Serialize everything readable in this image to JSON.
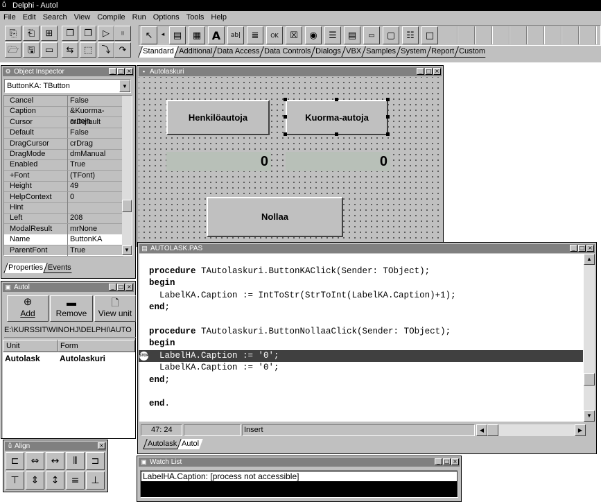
{
  "app": {
    "title": "Delphi - Autol"
  },
  "menu": [
    "File",
    "Edit",
    "Search",
    "View",
    "Compile",
    "Run",
    "Options",
    "Tools",
    "Help"
  ],
  "palette_tabs": [
    "Standard",
    "Additional",
    "Data Access",
    "Data Controls",
    "Dialogs",
    "VBX",
    "Samples",
    "System",
    "Report",
    "Custom"
  ],
  "object_inspector": {
    "title": "Object Inspector",
    "selected": "ButtonKA: TButton",
    "properties": [
      {
        "k": "Cancel",
        "v": "False"
      },
      {
        "k": "Caption",
        "v": "&Kuorma-autoja"
      },
      {
        "k": "Cursor",
        "v": "crDefault"
      },
      {
        "k": "Default",
        "v": "False"
      },
      {
        "k": "DragCursor",
        "v": "crDrag"
      },
      {
        "k": "DragMode",
        "v": "dmManual"
      },
      {
        "k": "Enabled",
        "v": "True"
      },
      {
        "k": "+Font",
        "v": "(TFont)"
      },
      {
        "k": "Height",
        "v": "49"
      },
      {
        "k": "HelpContext",
        "v": "0"
      },
      {
        "k": "Hint",
        "v": ""
      },
      {
        "k": "Left",
        "v": "208"
      },
      {
        "k": "ModalResult",
        "v": "mrNone"
      },
      {
        "k": "Name",
        "v": "ButtonKA"
      },
      {
        "k": "ParentFont",
        "v": "True"
      }
    ],
    "tabs": [
      "Properties",
      "Events"
    ]
  },
  "project": {
    "title": "Autol",
    "buttons": [
      "Add",
      "Remove",
      "View unit"
    ],
    "path": "E:\\KURSSIT\\WINOHJ\\DELPHI\\AUTO",
    "col_unit": "Unit",
    "col_form": "Form",
    "row_unit": "Autolask",
    "row_form": "Autolaskuri"
  },
  "form": {
    "title": "Autolaskuri",
    "btn_ha": "Henkilöautoja",
    "btn_ka": "Kuorma-autoja",
    "label_ha": "0",
    "label_ka": "0",
    "btn_reset": "Nollaa"
  },
  "editor": {
    "title": "AUTOLASK.PAS",
    "lines": [
      {
        "kw": "procedure",
        "rest": " TAutolaskuri.ButtonKAClick(Sender: TObject);"
      },
      {
        "kw": "begin",
        "rest": ""
      },
      {
        "kw": "",
        "rest": "  LabelKA.Caption := IntToStr(StrToInt(LabelKA.Caption)+1);"
      },
      {
        "kw": "end",
        "rest": ";"
      },
      {
        "kw": "",
        "rest": ""
      },
      {
        "kw": "procedure",
        "rest": " TAutolaskuri.ButtonNollaaClick(Sender: TObject);"
      },
      {
        "kw": "begin",
        "rest": ""
      },
      {
        "kw": "",
        "rest": "  LabelHA.Caption := '0';"
      },
      {
        "kw": "",
        "rest": "  LabelKA.Caption := '0';"
      },
      {
        "kw": "end",
        "rest": ";"
      },
      {
        "kw": "",
        "rest": ""
      },
      {
        "kw": "end",
        "rest": "."
      }
    ],
    "stop_mark": "STOP",
    "status_pos": "47: 24",
    "status_mode": "Insert",
    "tabs": [
      "Autolask",
      "Autol"
    ]
  },
  "align": {
    "title": "Align"
  },
  "watch": {
    "title": "Watch List",
    "entry": "LabelHA.Caption: [process not accessible]"
  }
}
